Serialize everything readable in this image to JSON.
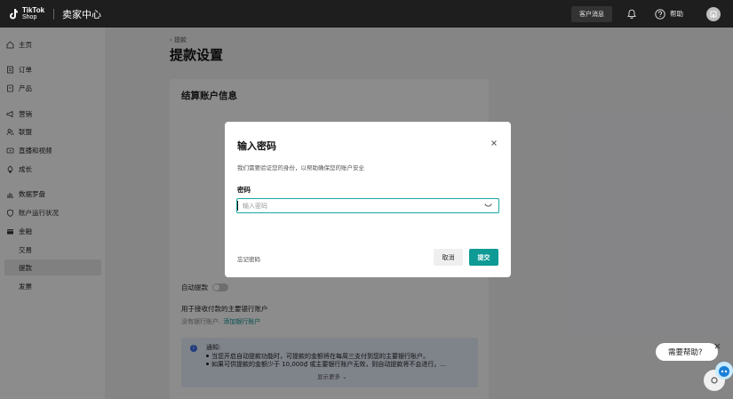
{
  "topbar": {
    "logo_line1": "TikTok",
    "logo_line2": "Shop",
    "brand_title": "卖家中心",
    "customer_messages": "客户消息",
    "help": "帮助"
  },
  "sidebar": {
    "items": [
      {
        "label": "主页",
        "icon": "home-icon"
      },
      {
        "label": "订单",
        "icon": "order-icon"
      },
      {
        "label": "产品",
        "icon": "product-icon"
      },
      {
        "label": "营销",
        "icon": "megaphone-icon"
      },
      {
        "label": "联盟",
        "icon": "people-icon"
      },
      {
        "label": "直播和视频",
        "icon": "video-icon"
      },
      {
        "label": "成长",
        "icon": "growth-icon"
      },
      {
        "label": "数据罗盘",
        "icon": "chart-icon"
      },
      {
        "label": "账户运行状况",
        "icon": "shield-icon"
      },
      {
        "label": "金融",
        "icon": "wallet-icon"
      }
    ],
    "sub_items": [
      "交易",
      "提款",
      "发票"
    ]
  },
  "main": {
    "back_label": "提款",
    "page_title": "提款设置",
    "settlement_header": "结算账户信息",
    "auto_withdraw_label": "自动提款",
    "bank_heading": "用于接收付款的主要银行账户",
    "no_bank_text": "没有银行账户.",
    "add_bank_link": "添加银行账户",
    "notice": {
      "title": "通知:",
      "line1": "当您开启自动提款功能时，可提款的金额将在每周三支付到您的主要银行账户。",
      "line2": "如果可供提款的金额少于 10,000₫ 或主要银行账户无效，则自动提款将不会进行。...",
      "show_more": "显示更多"
    }
  },
  "modal": {
    "title": "输入密码",
    "description": "我们需要验证您的身份，以帮助确保您的账户安全",
    "password_label": "密码",
    "password_placeholder": "输入密码",
    "password_value": "",
    "forgot_password": "忘记密码",
    "cancel": "取消",
    "submit": "提交"
  },
  "help_float": {
    "label": "需要帮助?"
  },
  "colors": {
    "accent": "#0e9a95",
    "link": "#0c8d8b",
    "topbar": "#1e1e1e"
  }
}
